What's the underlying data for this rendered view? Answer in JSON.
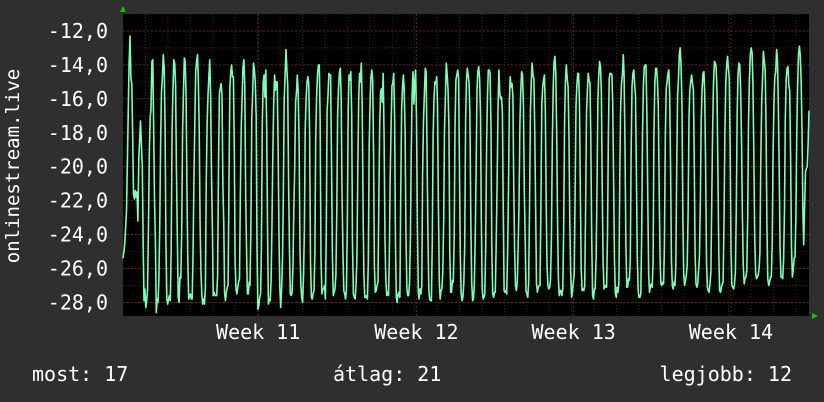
{
  "chart_data": {
    "type": "line",
    "ylabel": "onlinestream.live",
    "ylim": [
      -28.8,
      -11.0
    ],
    "yticks": [
      {
        "value": -12,
        "label": "-12,0"
      },
      {
        "value": -14,
        "label": "-14,0"
      },
      {
        "value": -16,
        "label": "-16,0"
      },
      {
        "value": -18,
        "label": "-18,0"
      },
      {
        "value": -20,
        "label": "-20,0"
      },
      {
        "value": -22,
        "label": "-22,0"
      },
      {
        "value": -24,
        "label": "-24,0"
      },
      {
        "value": -26,
        "label": "-26,0"
      },
      {
        "value": -28,
        "label": "-28,0"
      }
    ],
    "xlim": [
      0,
      685
    ],
    "xticks": [
      {
        "value": 135,
        "label": "Week 11"
      },
      {
        "value": 293,
        "label": "Week 12"
      },
      {
        "value": 450,
        "label": "Week 13"
      },
      {
        "value": 607,
        "label": "Week 14"
      }
    ],
    "grid": true,
    "colors": {
      "background": "#2f2f2f",
      "plot_bg": "#000000",
      "grid": "#5a2020",
      "line": "#7dffb4",
      "axis_arrow": "#00cc00",
      "text": "#ffffff"
    },
    "series": [
      {
        "values": [
          -25.4,
          -25.0,
          -24.5,
          -23.6,
          -22.6,
          -19.7,
          -16.6,
          -13.9,
          -12.3,
          -14.8,
          -15.1,
          -17.9,
          -21.6,
          -21.9,
          -21.4,
          -21.8,
          -21.5,
          -23.2,
          -19.5,
          -18.5,
          -17.3,
          -18.7,
          -20.0,
          -24.7,
          -27.9,
          -27.2,
          -28.3,
          -27.9,
          -27.3,
          -23.8,
          -19.3,
          -17.1,
          -16.6,
          -13.8,
          -13.7,
          -17.9,
          -21.9,
          -24.4,
          -28.6,
          -27.8,
          -28.0,
          -26.6,
          -23.2,
          -18.3,
          -15.6,
          -14.7,
          -13.4,
          -14.2,
          -17.7,
          -24.3,
          -27.8,
          -28.1,
          -27.8,
          -27.6,
          -27.9,
          -24.8,
          -17.7,
          -15.6,
          -13.7,
          -13.9,
          -15.2,
          -20.0,
          -24.0,
          -27.7,
          -28.0,
          -26.5,
          -26.6,
          -23.8,
          -17.9,
          -15.5,
          -13.6,
          -13.8,
          -15.9,
          -21.6,
          -25.5,
          -27.8,
          -27.6,
          -27.5,
          -27.8,
          -27.8,
          -24.9,
          -20.4,
          -17.5,
          -14.4,
          -13.8,
          -13.4,
          -14.8,
          -17.8,
          -23.4,
          -26.3,
          -27.6,
          -28.1,
          -27.8,
          -28.1,
          -27.1,
          -21.1,
          -17.6,
          -15.8,
          -14.7,
          -13.7,
          -15.7,
          -20.6,
          -23.6,
          -27.6,
          -27.4,
          -27.6,
          -27.6,
          -27.6,
          -26.4,
          -20.0,
          -15.7,
          -15.4,
          -15.1,
          -15.8,
          -21.2,
          -23.4,
          -27.5,
          -27.9,
          -27.4,
          -27.1,
          -27.0,
          -20.7,
          -15.3,
          -14.4,
          -14.0,
          -14.7,
          -14.7,
          -19.1,
          -25.6,
          -27.2,
          -27.5,
          -27.1,
          -26.8,
          -26.6,
          -21.4,
          -17.6,
          -15.7,
          -14.1,
          -13.7,
          -15.3,
          -21.7,
          -24.7,
          -27.5,
          -27.5,
          -26.8,
          -27.0,
          -23.5,
          -17.1,
          -15.6,
          -13.9,
          -14.3,
          -15.0,
          -17.1,
          -24.8,
          -28.4,
          -28.2,
          -27.7,
          -27.5,
          -24.9,
          -17.4,
          -15.0,
          -14.6,
          -15.9,
          -14.3,
          -17.8,
          -24.0,
          -28.1,
          -27.8,
          -27.9,
          -26.7,
          -23.7,
          -19.4,
          -16.3,
          -14.6,
          -15.5,
          -15.0,
          -15.0,
          -18.7,
          -23.8,
          -27.1,
          -28.3,
          -27.2,
          -25.4,
          -21.9,
          -16.1,
          -14.6,
          -13.1,
          -14.2,
          -15.2,
          -21.0,
          -25.0,
          -27.5,
          -27.6,
          -27.4,
          -25.8,
          -22.5,
          -20.1,
          -16.2,
          -15.6,
          -14.6,
          -15.6,
          -18.6,
          -24.9,
          -27.0,
          -27.7,
          -28.0,
          -26.5,
          -23.7,
          -17.8,
          -16.0,
          -15.0,
          -14.7,
          -15.1,
          -17.8,
          -25.6,
          -27.7,
          -27.8,
          -27.5,
          -27.3,
          -25.1,
          -18.4,
          -15.9,
          -14.6,
          -14.0,
          -14.0,
          -17.0,
          -25.4,
          -27.5,
          -27.2,
          -27.2,
          -27.0,
          -27.8,
          -23.8,
          -16.7,
          -15.8,
          -14.5,
          -14.6,
          -14.6,
          -19.7,
          -25.2,
          -27.6,
          -27.4,
          -27.2,
          -26.4,
          -22.6,
          -17.1,
          -15.4,
          -14.5,
          -14.2,
          -16.0,
          -21.4,
          -24.9,
          -27.3,
          -27.5,
          -27.8,
          -27.3,
          -23.5,
          -16.7,
          -14.6,
          -14.9,
          -14.4,
          -17.0,
          -24.5,
          -27.5,
          -27.7,
          -27.8,
          -27.0,
          -25.5,
          -20.2,
          -16.0,
          -14.5,
          -15.0,
          -13.9,
          -16.4,
          -22.6,
          -26.4,
          -27.7,
          -27.7,
          -27.6,
          -27.8,
          -25.7,
          -18.7,
          -16.2,
          -14.8,
          -14.3,
          -14.9,
          -19.5,
          -25.9,
          -27.4,
          -27.3,
          -27.0,
          -26.8,
          -22.1,
          -17.6,
          -15.6,
          -15.4,
          -16.2,
          -14.5,
          -18.3,
          -24.3,
          -26.6,
          -27.6,
          -27.4,
          -27.6,
          -25.5,
          -20.6,
          -17.6,
          -15.2,
          -15.1,
          -14.5,
          -17.0,
          -24.6,
          -27.7,
          -28.0,
          -27.5,
          -27.4,
          -27.7,
          -21.9,
          -16.7,
          -15.3,
          -14.6,
          -15.5,
          -17.9,
          -24.2,
          -27.2,
          -27.6,
          -27.6,
          -26.9,
          -24.3,
          -19.4,
          -15.8,
          -14.4,
          -16.3,
          -15.0,
          -14.3,
          -17.2,
          -23.4,
          -27.4,
          -27.8,
          -27.2,
          -27.5,
          -27.0,
          -20.4,
          -17.3,
          -15.7,
          -14.2,
          -14.4,
          -18.9,
          -23.8,
          -27.2,
          -27.8,
          -27.9,
          -27.9,
          -24.3,
          -18.3,
          -16.0,
          -15.0,
          -15.1,
          -14.7,
          -16.4,
          -22.1,
          -26.8,
          -27.8,
          -27.3,
          -27.2,
          -26.2,
          -23.1,
          -17.8,
          -15.9,
          -13.9,
          -14.6,
          -15.4,
          -17.5,
          -25.1,
          -27.4,
          -27.4,
          -26.7,
          -26.8,
          -24.2,
          -17.7,
          -14.9,
          -14.6,
          -14.3,
          -14.8,
          -19.7,
          -25.2,
          -27.5,
          -27.9,
          -27.7,
          -26.9,
          -24.7,
          -17.4,
          -15.0,
          -14.2,
          -14.6,
          -15.1,
          -16.9,
          -23.0,
          -26.8,
          -27.9,
          -27.8,
          -27.0,
          -24.3,
          -20.2,
          -15.5,
          -14.4,
          -14.1,
          -14.8,
          -16.9,
          -23.0,
          -27.2,
          -27.8,
          -27.7,
          -27.5,
          -24.8,
          -18.7,
          -15.8,
          -14.3,
          -14.3,
          -14.5,
          -17.7,
          -24.8,
          -27.5,
          -27.7,
          -27.4,
          -27.4,
          -24.5,
          -21.0,
          -16.6,
          -14.3,
          -15.6,
          -16.0,
          -15.9,
          -16.8,
          -22.2,
          -27.3,
          -27.4,
          -27.3,
          -27.5,
          -25.1,
          -21.3,
          -16.1,
          -14.7,
          -15.3,
          -15.1,
          -15.9,
          -20.9,
          -24.9,
          -27.0,
          -27.3,
          -26.8,
          -24.8,
          -22.3,
          -17.5,
          -15.5,
          -14.4,
          -14.6,
          -16.3,
          -21.4,
          -24.0,
          -27.3,
          -27.5,
          -27.7,
          -26.9,
          -22.7,
          -16.8,
          -15.0,
          -13.9,
          -14.6,
          -14.8,
          -18.1,
          -22.7,
          -26.9,
          -27.4,
          -27.1,
          -27.0,
          -27.0,
          -22.5,
          -16.3,
          -15.3,
          -14.9,
          -14.6,
          -16.5,
          -22.1,
          -25.8,
          -27.0,
          -27.2,
          -27.1,
          -26.7,
          -24.2,
          -18.7,
          -15.4,
          -13.9,
          -13.5,
          -14.5,
          -18.0,
          -23.5,
          -26.6,
          -27.6,
          -27.3,
          -27.3,
          -27.6,
          -27.2,
          -23.5,
          -17.3,
          -15.0,
          -14.0,
          -14.8,
          -15.3,
          -17.9,
          -23.3,
          -26.3,
          -27.7,
          -27.4,
          -26.8,
          -26.4,
          -21.8,
          -16.4,
          -15.3,
          -14.5,
          -14.5,
          -16.4,
          -21.3,
          -26.0,
          -27.3,
          -27.2,
          -27.3,
          -27.0,
          -22.6,
          -16.9,
          -15.6,
          -14.5,
          -14.9,
          -15.1,
          -18.3,
          -24.2,
          -27.6,
          -27.8,
          -27.2,
          -27.2,
          -25.4,
          -21.2,
          -16.1,
          -14.7,
          -13.8,
          -14.1,
          -15.7,
          -21.2,
          -25.6,
          -27.2,
          -27.1,
          -27.0,
          -27.1,
          -24.0,
          -18.1,
          -14.8,
          -14.5,
          -14.5,
          -14.6,
          -16.2,
          -20.7,
          -25.6,
          -27.5,
          -27.7,
          -27.1,
          -27.4,
          -26.8,
          -20.5,
          -16.6,
          -15.1,
          -14.6,
          -13.4,
          -14.7,
          -18.8,
          -24.6,
          -27.1,
          -27.1,
          -26.6,
          -26.7,
          -25.5,
          -19.4,
          -15.3,
          -14.5,
          -14.3,
          -15.2,
          -15.8,
          -20.4,
          -25.4,
          -27.3,
          -27.7,
          -27.7,
          -27.5,
          -23.9,
          -18.1,
          -15.2,
          -14.1,
          -14.0,
          -14.0,
          -17.0,
          -22.0,
          -26.4,
          -27.4,
          -27.1,
          -26.9,
          -27.1,
          -25.6,
          -18.2,
          -15.2,
          -14.2,
          -14.2,
          -14.9,
          -16.5,
          -21.5,
          -25.5,
          -26.9,
          -27.0,
          -26.8,
          -26.9,
          -24.7,
          -18.3,
          -15.4,
          -15.0,
          -14.5,
          -14.3,
          -15.8,
          -20.1,
          -25.4,
          -27.0,
          -27.2,
          -26.8,
          -27.0,
          -25.9,
          -20.1,
          -15.8,
          -14.8,
          -13.4,
          -13.0,
          -14.1,
          -16.4,
          -22.8,
          -26.3,
          -27.0,
          -26.7,
          -26.4,
          -25.8,
          -22.8,
          -17.1,
          -15.5,
          -15.0,
          -14.6,
          -15.1,
          -15.5,
          -19.3,
          -25.2,
          -26.9,
          -27.1,
          -26.9,
          -26.1,
          -25.2,
          -21.8,
          -17.3,
          -15.4,
          -14.5,
          -14.4,
          -15.7,
          -19.9,
          -25.6,
          -27.1,
          -27.3,
          -27.4,
          -26.9,
          -26.2,
          -21.8,
          -18.0,
          -15.1,
          -13.8,
          -13.9,
          -14.1,
          -15.6,
          -20.2,
          -25.1,
          -27.3,
          -27.4,
          -27.1,
          -26.9,
          -26.8,
          -23.3,
          -18.0,
          -15.0,
          -14.1,
          -13.5,
          -14.2,
          -14.8,
          -18.6,
          -24.9,
          -27.0,
          -27.1,
          -27.2,
          -26.9,
          -26.2,
          -22.4,
          -16.8,
          -14.6,
          -13.9,
          -14.0,
          -15.6,
          -18.3,
          -22.9,
          -25.9,
          -26.9,
          -26.6,
          -26.5,
          -26.1,
          -23.0,
          -17.5,
          -14.9,
          -13.4,
          -13.0,
          -13.3,
          -15.0,
          -19.1,
          -24.1,
          -26.2,
          -26.6,
          -26.5,
          -26.4,
          -26.0,
          -25.1,
          -19.6,
          -16.2,
          -14.7,
          -13.2,
          -13.8,
          -14.3,
          -17.8,
          -23.4,
          -26.6,
          -27.0,
          -26.8,
          -26.5,
          -26.5,
          -24.5,
          -19.1,
          -16.2,
          -14.7,
          -14.4,
          -13.1,
          -13.8,
          -16.2,
          -20.2,
          -24.9,
          -26.5,
          -26.5,
          -26.6,
          -25.5,
          -22.5,
          -17.2,
          -14.8,
          -14.2,
          -14.1,
          -15.2,
          -15.5,
          -19.4,
          -24.8,
          -26.5,
          -26.1,
          -25.4,
          -25.3,
          -23.0,
          -18.5,
          -15.3,
          -13.4,
          -12.9,
          -13.4,
          -14.8,
          -17.8,
          -22.6,
          -24.6,
          -22.4,
          -20.3,
          -20.1,
          -20.0,
          -18.7,
          -16.7
        ]
      }
    ]
  },
  "footer": {
    "current": "most: 17",
    "average": "átlag: 21",
    "max": "legjobb: 12"
  }
}
